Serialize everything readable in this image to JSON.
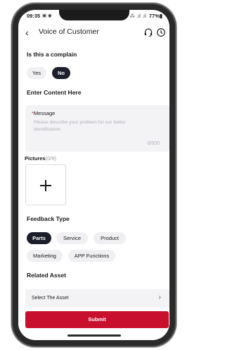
{
  "status_bar": {
    "time": "09:35",
    "left_icons": "▣ ◉",
    "signal": "⁂ .ıl .ıl",
    "battery": "77%▮"
  },
  "header": {
    "title": "Voice of Customer",
    "icons": [
      "headset-icon",
      "clock-icon"
    ]
  },
  "complain": {
    "question": "Is this a complain",
    "options": [
      {
        "label": "Yes",
        "selected": false
      },
      {
        "label": "No",
        "selected": true
      }
    ]
  },
  "content": {
    "section_title": "Enter Content Here",
    "required_mark": "*",
    "message_label": "Message",
    "placeholder": "Please describe your problem for our better identification.",
    "counter": "0/500"
  },
  "pictures": {
    "label": "Pictures",
    "count": "(0/9)"
  },
  "feedback": {
    "title": "Feedback Type",
    "types": [
      {
        "label": "Parts",
        "selected": true
      },
      {
        "label": "Service",
        "selected": false
      },
      {
        "label": "Product",
        "selected": false
      },
      {
        "label": "Marketing",
        "selected": false
      },
      {
        "label": "APP Functions",
        "selected": false
      }
    ]
  },
  "asset": {
    "title": "Related Asset",
    "select_label": "Select The Asset"
  },
  "submit_label": "Submit",
  "colors": {
    "accent_red": "#c8102e",
    "selected_pill": "#1c1f2b",
    "pill_bg": "#f0f0f3"
  }
}
